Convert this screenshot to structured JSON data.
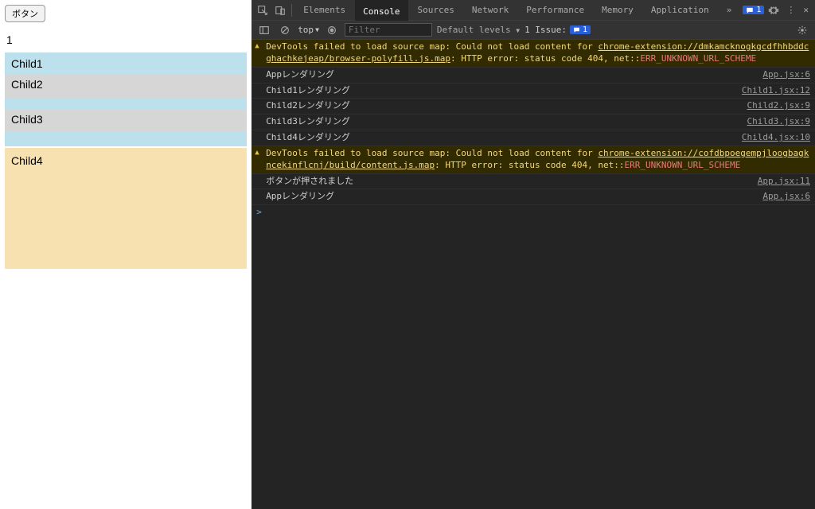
{
  "app": {
    "button_label": "ボタン",
    "counter_value": "1",
    "child1": "Child1",
    "child2": "Child2",
    "child3": "Child3",
    "child4": "Child4"
  },
  "devtools": {
    "tabs": {
      "elements": "Elements",
      "console": "Console",
      "sources": "Sources",
      "network": "Network",
      "performance": "Performance",
      "memory": "Memory",
      "application": "Application",
      "more": "»"
    },
    "issue_badge": "1",
    "toolbar": {
      "context": "top",
      "filter_placeholder": "Filter",
      "levels": "Default levels",
      "issues_label": "1 Issue:",
      "issues_count": "1"
    },
    "logs": {
      "warn1_a": "DevTools failed to load source map: Could not load content for ",
      "warn1_url": "chrome-extension://dmkamcknogkgcdfhhbddcghachkejeap/browser-polyfill.js.map",
      "warn1_b": ": HTTP error: status code 404, net::",
      "warn1_err": "ERR_UNKNOWN_URL_SCHEME",
      "l1_msg": "Appレンダリング",
      "l1_src": "App.jsx:6",
      "l2_msg": "Child1レンダリング",
      "l2_src": "Child1.jsx:12",
      "l3_msg": "Child2レンダリング",
      "l3_src": "Child2.jsx:9",
      "l4_msg": "Child3レンダリング",
      "l4_src": "Child3.jsx:9",
      "l5_msg": "Child4レンダリング",
      "l5_src": "Child4.jsx:10",
      "warn2_a": "DevTools failed to load source map: Could not load content for ",
      "warn2_url": "chrome-extension://cofdbpoegempjloogbagkncekinflcnj/build/content.js.map",
      "warn2_b": ": HTTP error: status code 404, net::",
      "warn2_err": "ERR_UNKNOWN_URL_SCHEME",
      "l6_msg": "ボタンが押されました",
      "l6_src": "App.jsx:11",
      "l7_msg": "Appレンダリング",
      "l7_src": "App.jsx:6"
    },
    "prompt": ">"
  }
}
